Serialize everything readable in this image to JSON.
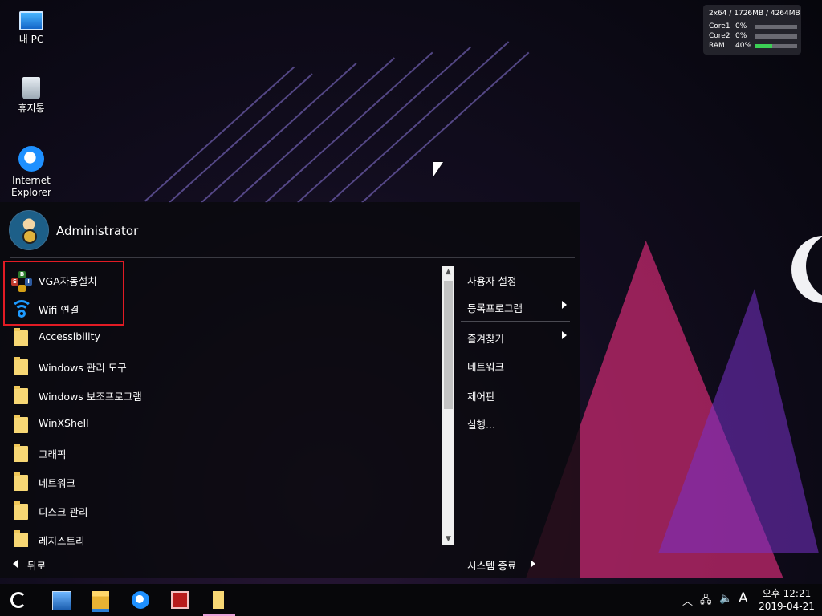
{
  "desktop": {
    "icons": [
      {
        "label": "내 PC"
      },
      {
        "label": "휴지통"
      },
      {
        "label_line1": "Internet",
        "label_line2": "Explorer"
      }
    ]
  },
  "sysmon": {
    "header": "2x64 / 1726MB / 4264MB",
    "rows": [
      {
        "label": "Core1",
        "value": "0%",
        "level": 0
      },
      {
        "label": "Core2",
        "value": "0%",
        "level": 0
      },
      {
        "label": "RAM",
        "value": "40%",
        "level": 0.4
      }
    ],
    "bar_color": "#3ccf55"
  },
  "start_menu": {
    "username": "Administrator",
    "programs": [
      {
        "label": "VGA자동설치",
        "icon": "vga-installer-icon"
      },
      {
        "label": "Wifi 연결",
        "icon": "wifi-icon"
      },
      {
        "label": "Accessibility",
        "icon": "folder-icon"
      },
      {
        "label": "Windows 관리 도구",
        "icon": "folder-icon"
      },
      {
        "label": "Windows 보조프로그램",
        "icon": "folder-icon"
      },
      {
        "label": "WinXShell",
        "icon": "folder-icon"
      },
      {
        "label": "그래픽",
        "icon": "folder-icon"
      },
      {
        "label": "네트워크",
        "icon": "folder-icon"
      },
      {
        "label": "디스크 관리",
        "icon": "folder-icon"
      },
      {
        "label": "레지스트리",
        "icon": "folder-icon"
      }
    ],
    "right_items": [
      {
        "label": "사용자 설정"
      },
      {
        "label": "등록프로그램"
      },
      {
        "label": "즐겨찾기"
      },
      {
        "label": "네트워크"
      },
      {
        "label": "제어판"
      },
      {
        "label": "실행..."
      }
    ],
    "back_label": "뒤로",
    "shutdown_label": "시스템 종료",
    "highlight_color": "#e21b24"
  },
  "taskbar": {
    "apps": [
      "start-icon",
      "computer-management-icon",
      "file-explorer-icon",
      "internet-explorer-icon",
      "app-red-icon",
      "folder-icon"
    ],
    "tray": {
      "ime": "A",
      "time": "오후 12:21",
      "date": "2019-04-21"
    }
  }
}
